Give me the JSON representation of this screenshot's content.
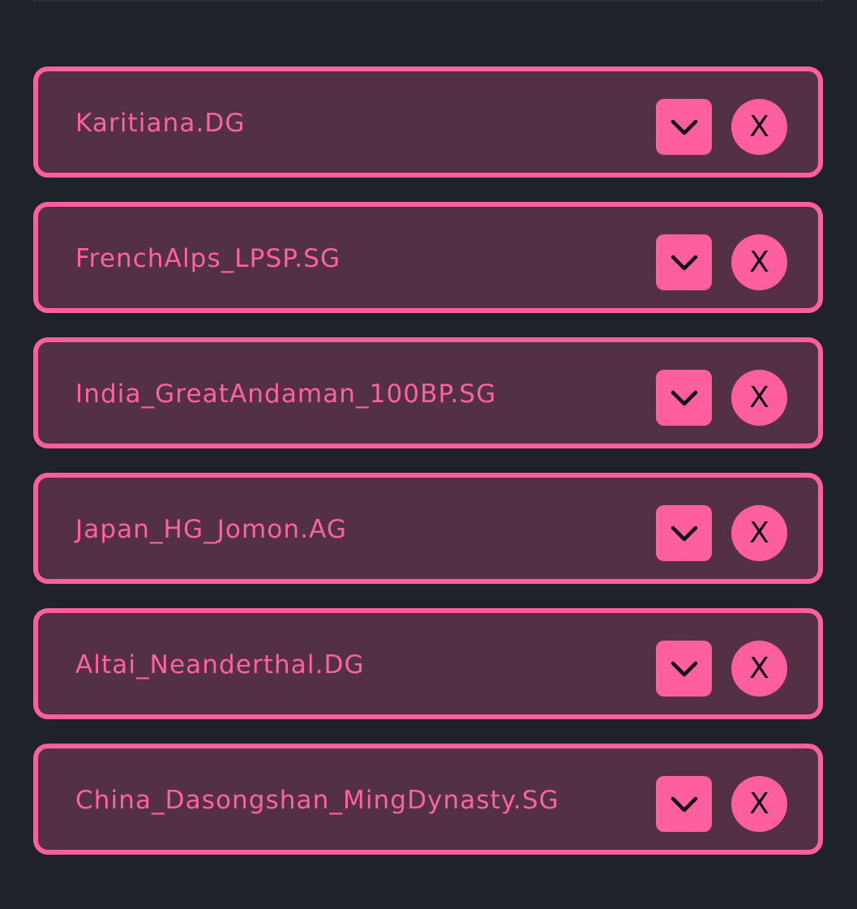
{
  "populations": [
    {
      "name": "Karitiana.DG"
    },
    {
      "name": "FrenchAlps_LPSP.SG"
    },
    {
      "name": "India_GreatAndaman_100BP.SG"
    },
    {
      "name": "Japan_HG_Jomon.AG"
    },
    {
      "name": "Altai_Neanderthal.DG"
    },
    {
      "name": "China_Dasongshan_MingDynasty.SG"
    }
  ],
  "remove_glyph": "X",
  "icons": {
    "expand": "chevron-down-icon",
    "remove": "close-icon"
  },
  "colors": {
    "background": "#1f2229",
    "card_fill": "#533043",
    "accent": "#ff5f9e",
    "label_text": "#ff62a1",
    "icon": "#111111"
  }
}
